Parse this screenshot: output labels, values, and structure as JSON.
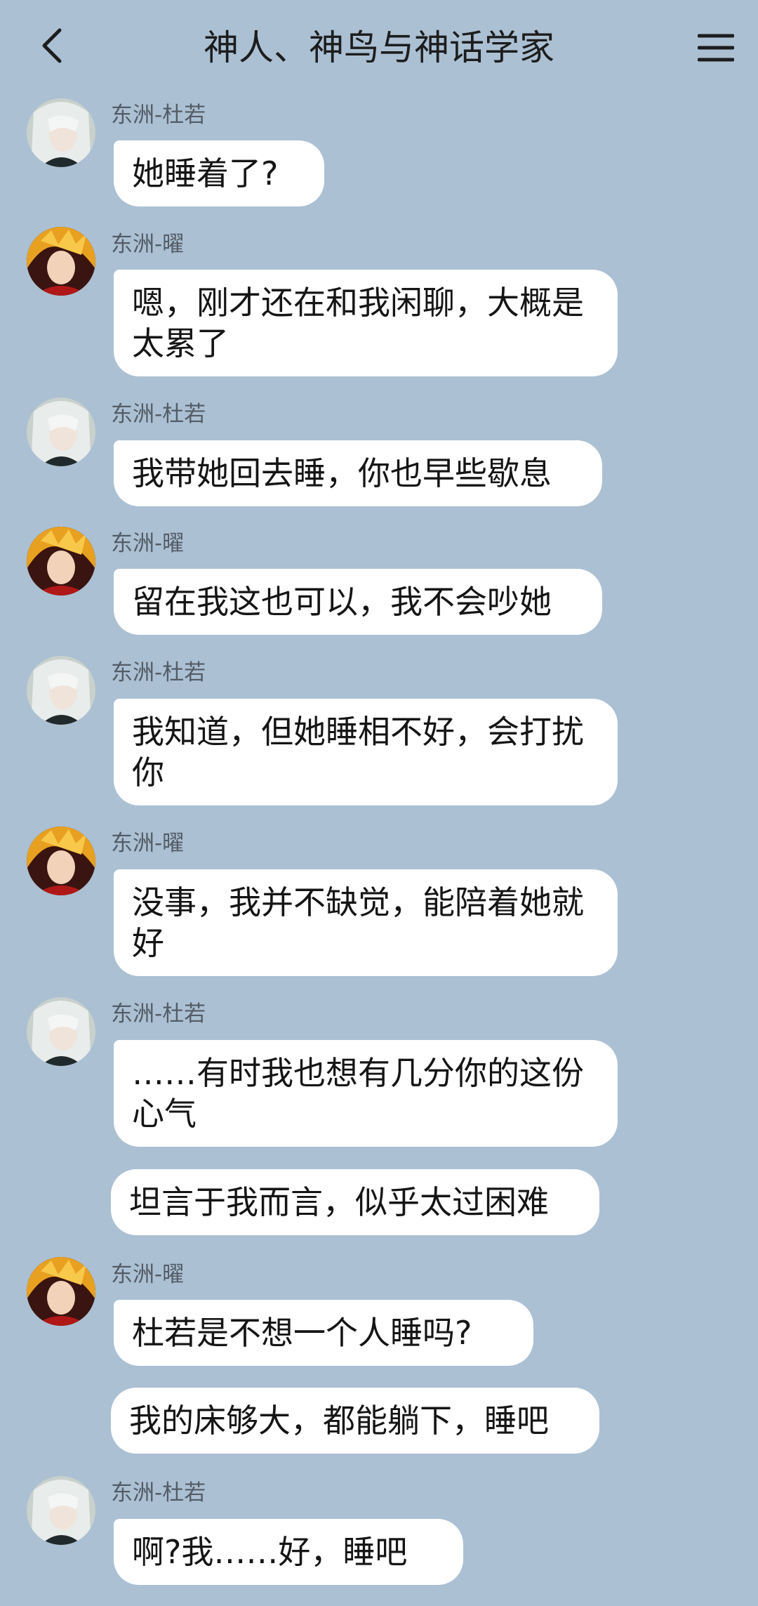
{
  "header": {
    "title": "神人、神鸟与神话学家",
    "back_icon": "chevron-left-icon",
    "menu_icon": "hamburger-menu-icon"
  },
  "colors": {
    "background": "#abc0d3",
    "bubble": "#ffffff",
    "text": "#151515",
    "sender": "#535c66"
  },
  "messages": [
    {
      "sender": "东洲-杜若",
      "avatar": "duruo",
      "bubbles": [
        "她睡着了?"
      ]
    },
    {
      "sender": "东洲-曜",
      "avatar": "yao",
      "bubbles": [
        "嗯，刚才还在和我闲聊，大概是太累了"
      ]
    },
    {
      "sender": "东洲-杜若",
      "avatar": "duruo",
      "bubbles": [
        "我带她回去睡，你也早些歇息"
      ]
    },
    {
      "sender": "东洲-曜",
      "avatar": "yao",
      "bubbles": [
        "留在我这也可以，我不会吵她"
      ]
    },
    {
      "sender": "东洲-杜若",
      "avatar": "duruo",
      "bubbles": [
        "我知道，但她睡相不好，会打扰你"
      ]
    },
    {
      "sender": "东洲-曜",
      "avatar": "yao",
      "bubbles": [
        "没事，我并不缺觉，能陪着她就好"
      ]
    },
    {
      "sender": "东洲-杜若",
      "avatar": "duruo",
      "bubbles": [
        "……有时我也想有几分你的这份心气",
        "坦言于我而言，似乎太过困难"
      ]
    },
    {
      "sender": "东洲-曜",
      "avatar": "yao",
      "bubbles": [
        "杜若是不想一个人睡吗?",
        "我的床够大，都能躺下，睡吧"
      ]
    },
    {
      "sender": "东洲-杜若",
      "avatar": "duruo",
      "bubbles": [
        "啊?我……好，睡吧"
      ]
    }
  ]
}
